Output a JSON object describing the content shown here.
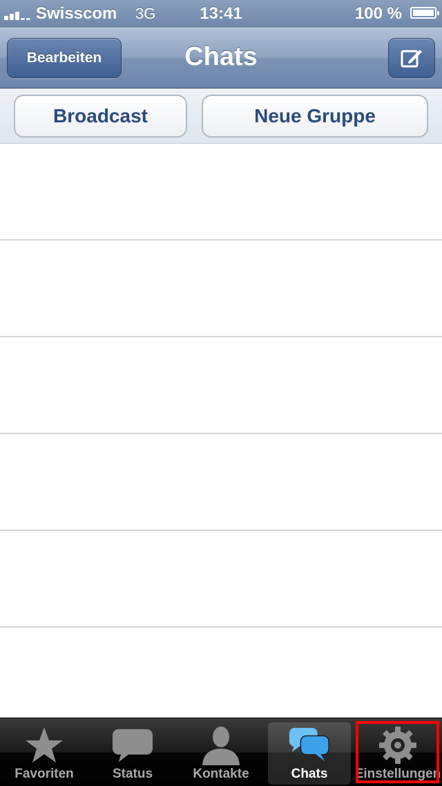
{
  "status_bar": {
    "carrier": "Swisscom",
    "network": "3G",
    "time": "13:41",
    "battery": "100 %"
  },
  "nav_bar": {
    "edit_label": "Bearbeiten",
    "title": "Chats",
    "compose_icon": "compose-icon"
  },
  "actions": {
    "broadcast_label": "Broadcast",
    "new_group_label": "Neue Gruppe"
  },
  "tab_bar": {
    "favorites": "Favoriten",
    "status": "Status",
    "contacts": "Kontakte",
    "chats": "Chats",
    "settings": "Einstellungen",
    "active_tab": "chats"
  },
  "colors": {
    "nav_blue": "#6d86ab",
    "button_text": "#2b4b7e",
    "highlight": "#ff0000",
    "chats_icon": "#3da0ea"
  }
}
